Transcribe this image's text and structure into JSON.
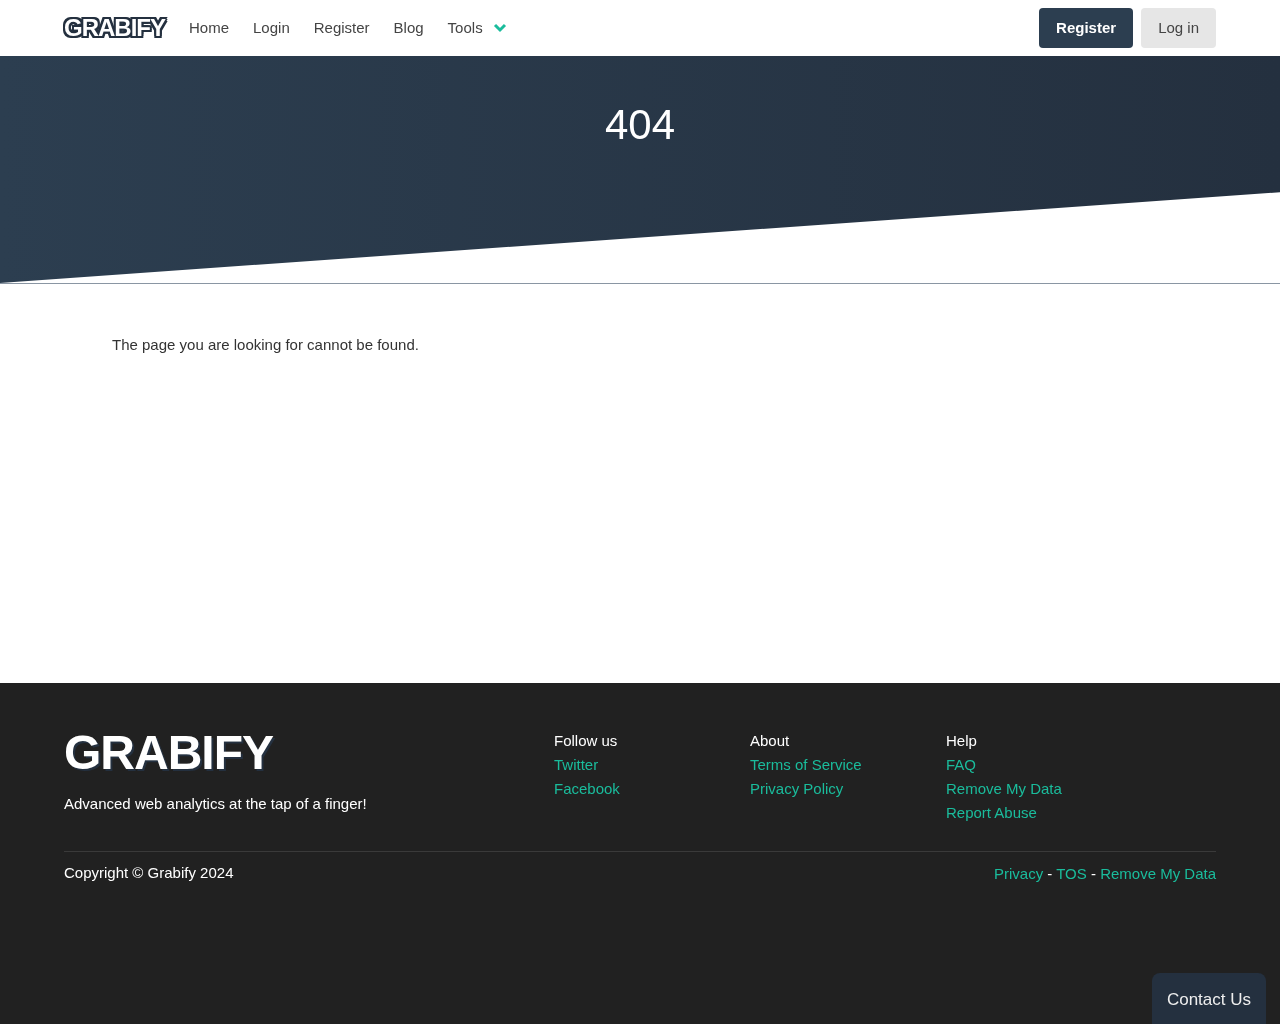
{
  "navbar": {
    "logo": "GRABIFY",
    "links": [
      {
        "label": "Home"
      },
      {
        "label": "Login"
      },
      {
        "label": "Register"
      },
      {
        "label": "Blog"
      },
      {
        "label": "Tools",
        "dropdown": true
      }
    ],
    "buttons": [
      {
        "label": "Register",
        "kind": "primary"
      },
      {
        "label": "Log in",
        "kind": "secondary"
      }
    ]
  },
  "hero": {
    "title": "404"
  },
  "message": "The page you are looking for cannot be found.",
  "footer": {
    "logo": "GRABIFY",
    "tagline": "Advanced web analytics at the tap of a finger!",
    "columns": [
      {
        "heading": "Follow us",
        "links": [
          "Twitter",
          "Facebook"
        ]
      },
      {
        "heading": "About",
        "links": [
          "Terms of Service",
          "Privacy Policy"
        ]
      },
      {
        "heading": "Help",
        "links": [
          "FAQ",
          "Remove My Data",
          "Report Abuse"
        ]
      }
    ],
    "copyright": "Copyright © Grabify 2024",
    "bottom_links": [
      "Privacy",
      "TOS",
      "Remove My Data"
    ],
    "separator": "-"
  },
  "contact_button": "Contact Us"
}
